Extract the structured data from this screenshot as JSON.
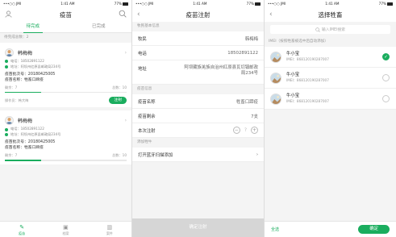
{
  "status_bar": {
    "carrier": "•••○○ JMI",
    "time": "1:41 AM",
    "battery": "77%"
  },
  "screen1": {
    "title": "疫苗",
    "tabs": [
      "待完成",
      "已完成"
    ],
    "section_label": "待完成总数：2",
    "cards": [
      {
        "name": "韩梅梅",
        "phone": "电话：18502891122",
        "address": "地址：阿坝州红原县邮政局234号",
        "batch": "疫苗批次号：20180425005",
        "vaccine": "疫苗名称：牲畜口蹄疫",
        "remaining": "剩余：7",
        "total": "总数：10",
        "progress": 0.3,
        "operator": "操作员：韩大梅",
        "action": "注射"
      },
      {
        "name": "韩梅梅",
        "phone": "电话：18502891122",
        "address": "地址：阿坝州红原县邮政局234号",
        "batch": "疫苗批次号：20180425005",
        "vaccine": "疫苗名称：牲畜口蹄疫",
        "remaining": "剩余：7",
        "total": "总数：10",
        "progress": 0.3
      }
    ],
    "tabbar": [
      {
        "label": "疫苗",
        "icon": "syringe-icon"
      },
      {
        "label": "档案",
        "icon": "archive-icon"
      },
      {
        "label": "案件",
        "icon": "trash-icon"
      }
    ]
  },
  "screen2": {
    "title": "疫苗注射",
    "group_basic": "牧民基本信息",
    "herder_label": "牧民",
    "herder_value": "韩梅梅",
    "phone_label": "电话",
    "phone_value": "18502891122",
    "address_label": "地址",
    "address_value": "阿坝藏族羌族自治州红原县瓦切镇邮政局234号",
    "group_vaccine": "疫苗信息",
    "vaccine_label": "疫苗名称",
    "vaccine_value": "牲畜口蹄疫",
    "remaining_label": "疫苗剩余",
    "remaining_value": "7支",
    "inject_label": "本次注射",
    "inject_value": "?",
    "group_add": "添加牲牛",
    "bluetooth_label": "打开蓝牙扫描添加",
    "confirm": "确定注射"
  },
  "screen3": {
    "title": "选择牲畜",
    "search_placeholder": "输入IMEI搜索",
    "list_label": "IMEI（按照牲畜被选中后自动添加）",
    "pets": [
      {
        "name": "牛小宝",
        "imei": "IMEI：868120190287007",
        "selected": true
      },
      {
        "name": "牛小宝",
        "imei": "IMEI：868120190287007",
        "selected": false
      },
      {
        "name": "牛小宝",
        "imei": "IMEI：868120190287007",
        "selected": false
      }
    ],
    "select_all": "全选",
    "confirm": "确定"
  },
  "colors": {
    "accent": "#1aad5e",
    "disabled": "#d6d6d6"
  }
}
